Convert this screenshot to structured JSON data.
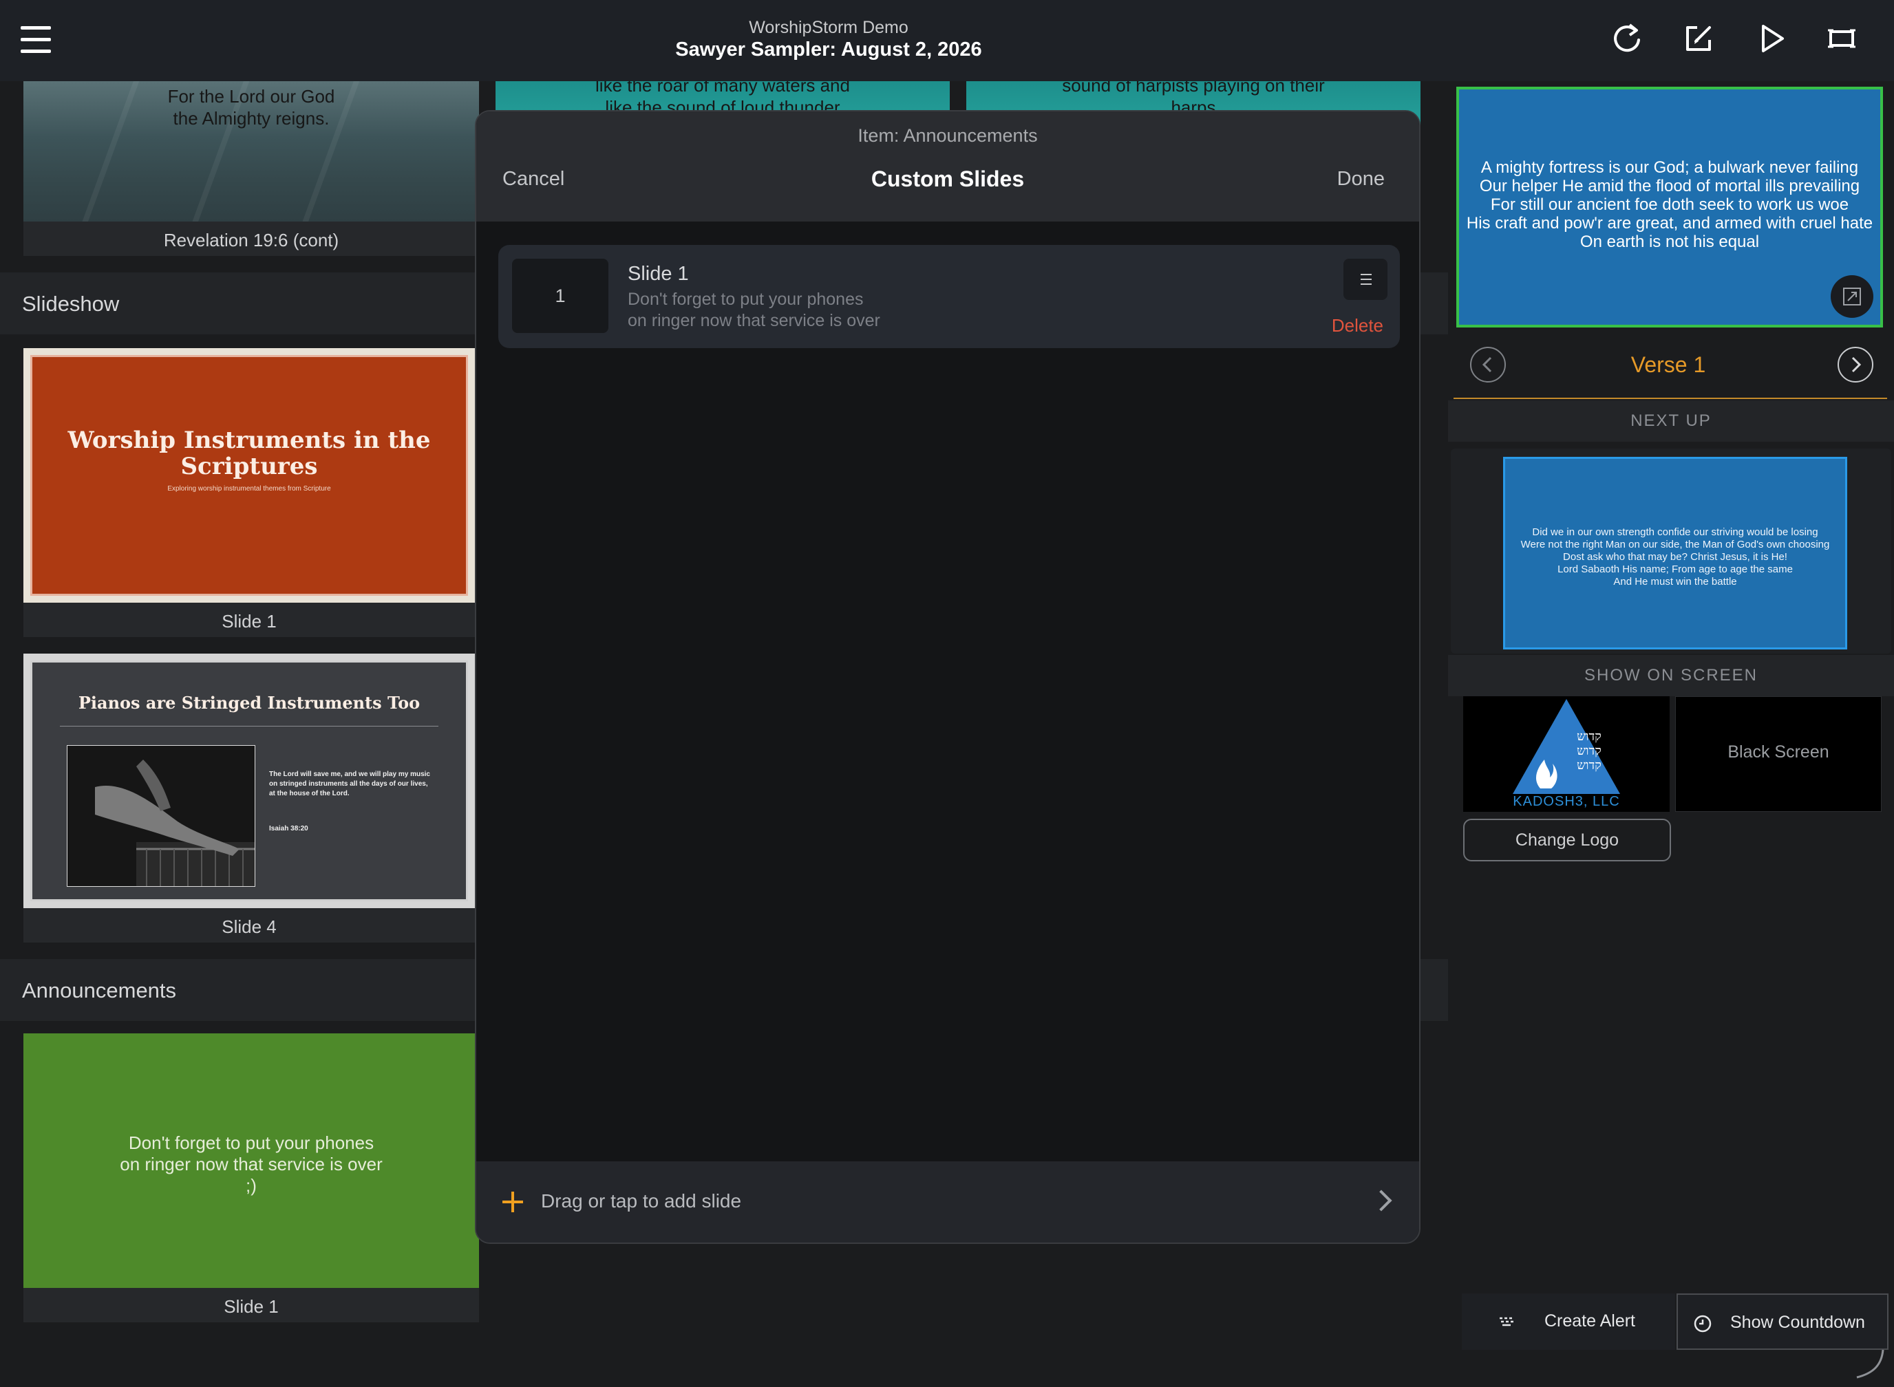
{
  "header": {
    "app_title": "WorshipStorm Demo",
    "event_title": "Sawyer Sampler: August 2, 2026",
    "icons": [
      "menu-icon",
      "refresh-icon",
      "edit-external-icon",
      "play-icon",
      "screen-icon"
    ]
  },
  "service": {
    "top_row": {
      "card1_text": "For the Lord our God\nthe Almighty reigns.",
      "card1_caption": "Revelation 19:6 (cont)",
      "card2_text": "like the roar of many waters and\nlike the sound of loud thunder",
      "card3_text": "sound of harpists playing on their\nharps"
    },
    "slideshow": {
      "title": "Slideshow",
      "slide1_title": "Worship Instruments in the Scriptures",
      "slide1_subtitle": "Exploring worship instrumental themes from Scripture",
      "slide1_caption": "Slide 1",
      "slide4_title": "Pianos are Stringed Instruments Too",
      "slide4_quote": "The Lord will save me, and we will play my music on stringed instruments all the days of our lives, at the house of the Lord.",
      "slide4_ref": "Isaiah 38:20",
      "slide4_caption": "Slide 4"
    },
    "announcements": {
      "title": "Announcements",
      "slide_text": "Don't forget to put your phones\non ringer now that service is over\n;)",
      "slide_caption": "Slide 1"
    }
  },
  "modal": {
    "item_label": "Item: Announcements",
    "title": "Custom Slides",
    "cancel_label": "Cancel",
    "done_label": "Done",
    "slides": [
      {
        "number": "1",
        "title": "Slide 1",
        "text": "Don't forget to put your phones\non ringer now that service is over",
        "delete_label": "Delete"
      }
    ],
    "add_label": "Drag or tap to add slide"
  },
  "preview": {
    "live_text": "A mighty fortress is our God; a bulwark never failing\nOur helper He amid the flood of mortal ills prevailing\nFor still our ancient foe doth seek to work us woe\nHis craft and pow'r are great, and armed with cruel hate\nOn earth is not his equal",
    "current_label": "Verse 1",
    "next_up_label": "NEXT UP",
    "next_text": "Did we in our own strength confide our striving would be losing\nWere not the right Man on our side, the Man of God's own choosing\nDost ask who that may be? Christ Jesus, it is He!\nLord Sabaoth His name; From age to age the same\nAnd He must win the battle",
    "show_on_screen_label": "SHOW ON SCREEN",
    "logo_text": "KADOSH3, LLC",
    "logo_hebrew": "קדוש",
    "black_screen_label": "Black Screen",
    "change_logo_label": "Change Logo",
    "create_alert_label": "Create Alert",
    "show_countdown_label": "Show Countdown"
  },
  "colors": {
    "accent": "#f0a020",
    "delete": "#e0543d",
    "live_border": "#39c048",
    "slide_blue": "#1f6fae",
    "announcement_green": "#4e8a2a",
    "slideshow_orange": "#ad3a12"
  }
}
